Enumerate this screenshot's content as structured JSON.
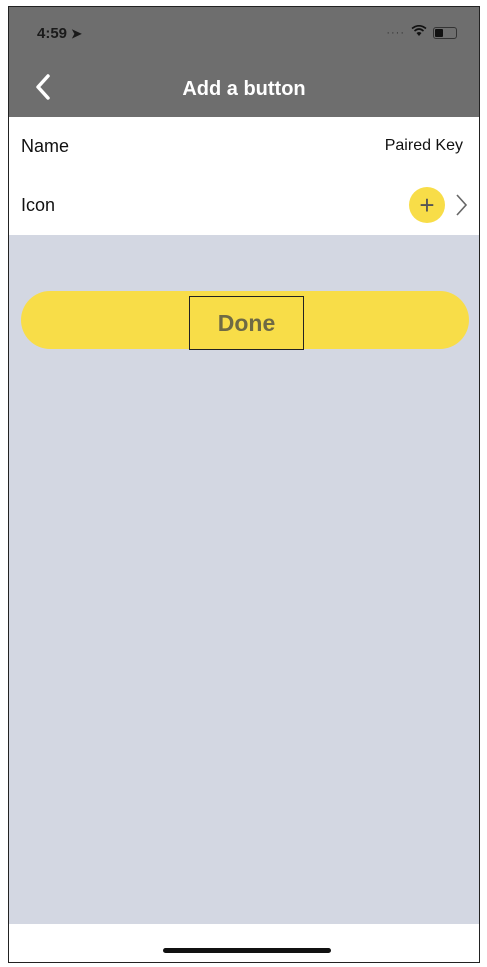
{
  "status_bar": {
    "time": "4:59"
  },
  "header": {
    "title": "Add a button"
  },
  "form": {
    "name": {
      "label": "Name",
      "value": "Paired Key"
    },
    "icon": {
      "label": "Icon",
      "add_symbol": "+"
    }
  },
  "actions": {
    "done_label": "Done"
  },
  "colors": {
    "accent": "#f8dd48",
    "header_bg": "#6e6e6e",
    "page_bg": "#d3d7e2"
  },
  "icons": [
    "location-arrow-icon",
    "wifi-icon",
    "battery-icon",
    "back-chevron-icon",
    "plus-icon",
    "chevron-right-icon"
  ]
}
